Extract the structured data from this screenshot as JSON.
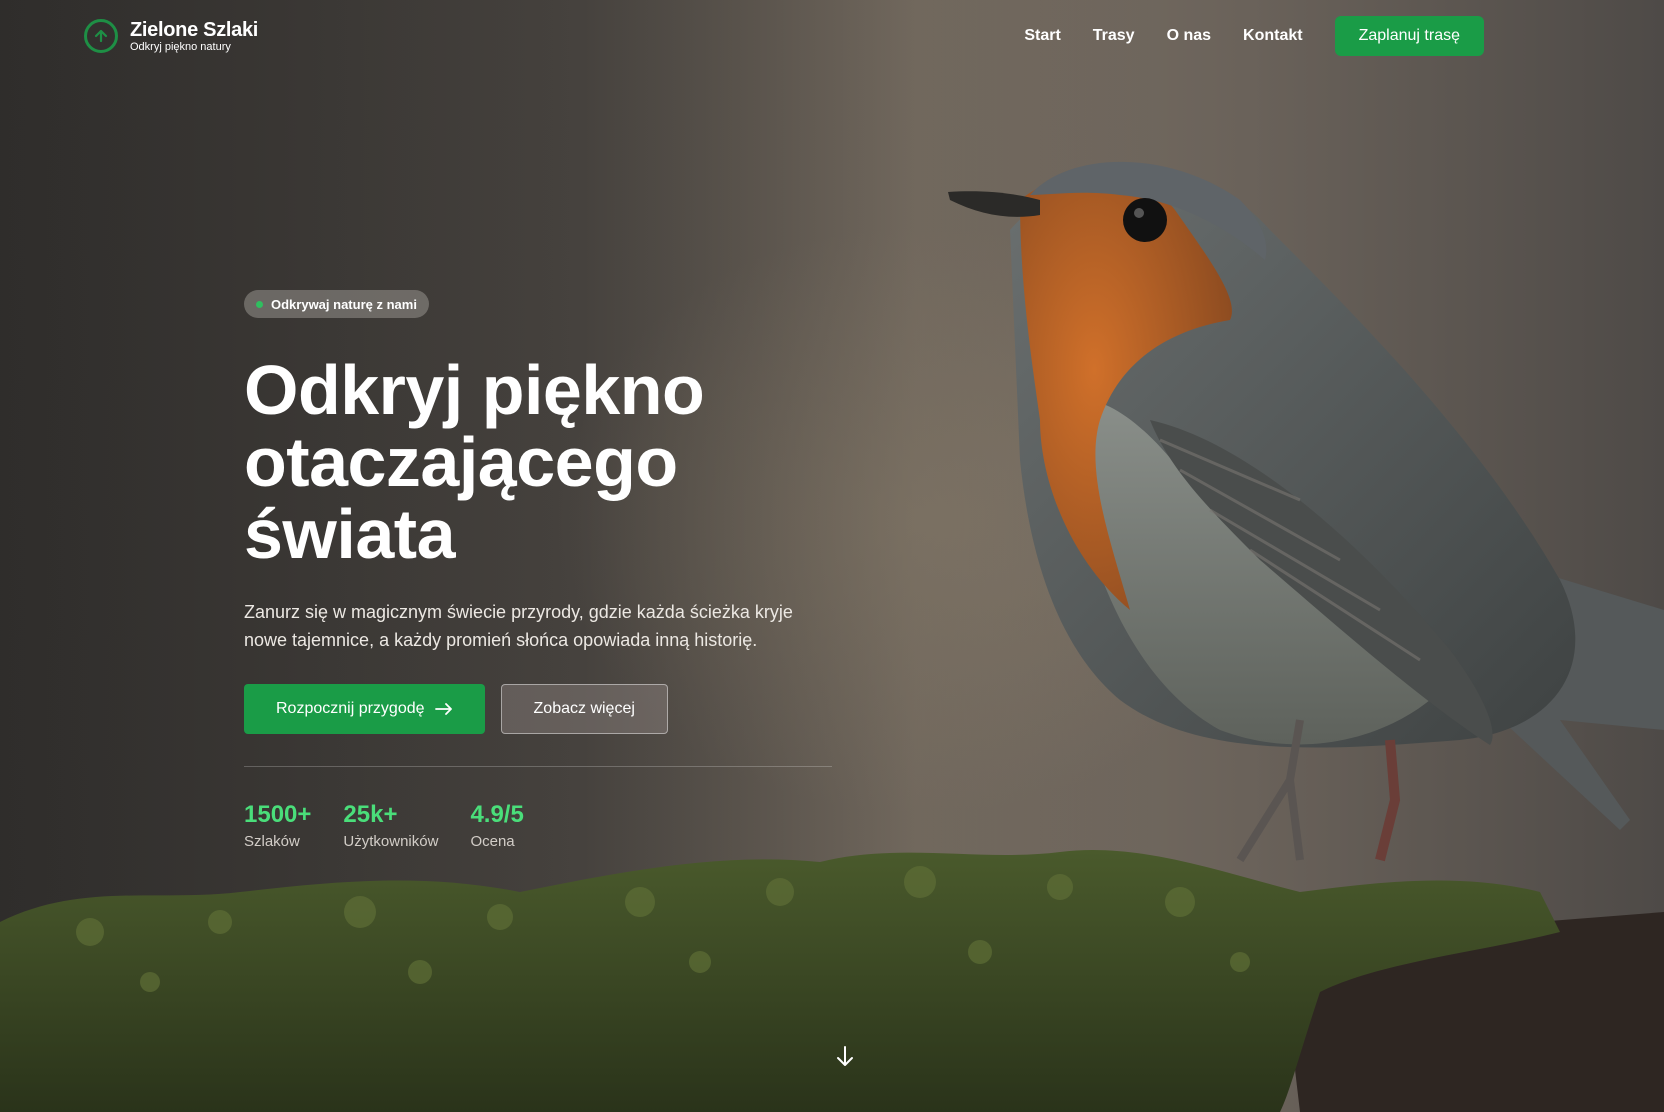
{
  "brand": {
    "title": "Zielone Szlaki",
    "subtitle": "Odkryj piękno natury",
    "logo_icon": "arrow-up-circle-icon"
  },
  "nav": {
    "items": [
      "Start",
      "Trasy",
      "O nas",
      "Kontakt"
    ],
    "cta": "Zaplanuj trasę"
  },
  "hero": {
    "badge": "Odkrywaj naturę z nami",
    "headline_lines": [
      "Odkryj piękno",
      "otaczającego",
      "świata"
    ],
    "lede": "Zanurz się w magicznym świecie przyrody, gdzie każda ścieżka kryje nowe tajemnice, a każdy promień słońca opowiada inną historię.",
    "primary_button": "Rozpocznij przygodę",
    "secondary_button": "Zobacz więcej",
    "stats": [
      {
        "value": "1500+",
        "label": "Szlaków"
      },
      {
        "value": "25k+",
        "label": "Użytkowników"
      },
      {
        "value": "4.9/5",
        "label": "Ocena"
      }
    ],
    "scroll_icon": "arrow-down-icon"
  },
  "colors": {
    "accent": "#1a9c47",
    "stat_value": "#4ade7a",
    "badge_dot": "#2fbf5f"
  }
}
